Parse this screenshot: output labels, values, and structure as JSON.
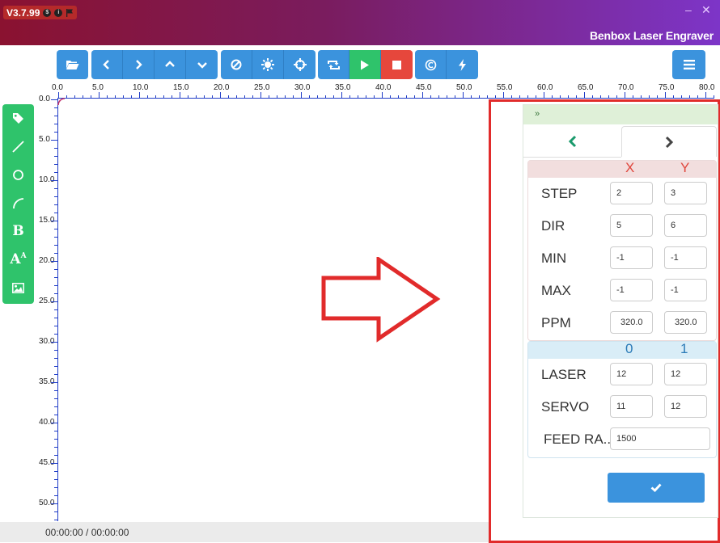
{
  "titlebar": {
    "version": "V3.7.99",
    "app_title": "Benbox Laser Engraver",
    "minimize": "–",
    "close": "✕"
  },
  "ruler": {
    "x_labels": [
      "0.0",
      "5.0",
      "10.0",
      "15.0",
      "20.0",
      "25.0",
      "30.0",
      "35.0",
      "40.0",
      "45.0",
      "50.0",
      "55.0",
      "60.0",
      "65.0",
      "70.0",
      "75.0",
      "80.0"
    ],
    "y_labels": [
      "0.0",
      "5.0",
      "10.0",
      "15.0",
      "20.0",
      "25.0",
      "30.0",
      "35.0",
      "40.0",
      "45.0",
      "50.0"
    ]
  },
  "toolbar": {
    "icons": [
      "folder-open",
      "chevron-left",
      "chevron-right",
      "chevron-up",
      "chevron-down",
      "ban",
      "sun",
      "crosshairs",
      "retweet",
      "play",
      "stop",
      "copyright",
      "bolt",
      "menu"
    ]
  },
  "tools": {
    "icons": [
      "tag",
      "line",
      "circle",
      "arc",
      "bold-text",
      "font-size",
      "image"
    ],
    "bold_label": "B",
    "font_label": "A"
  },
  "panel": {
    "collapse_label": "»",
    "tab_prev": "‹",
    "tab_next": "›",
    "axes": {
      "col_x": "X",
      "col_y": "Y",
      "rows": [
        {
          "label": "STEP",
          "x": "2",
          "y": "3"
        },
        {
          "label": "DIR",
          "x": "5",
          "y": "6"
        },
        {
          "label": "MIN",
          "x": "-1",
          "y": "-1"
        },
        {
          "label": "MAX",
          "x": "-1",
          "y": "-1"
        },
        {
          "label": "PPM",
          "x": "320.0",
          "y": "320.0"
        }
      ]
    },
    "outputs": {
      "col_0": "0",
      "col_1": "1",
      "rows": [
        {
          "label": "LASER",
          "v0": "12",
          "v1": "12"
        },
        {
          "label": "SERVO",
          "v0": "11",
          "v1": "12"
        }
      ],
      "feed_label": "FEED RA..",
      "feed_value": "1500"
    },
    "confirm_icon": "checkmark"
  },
  "status": {
    "time": "00:00:00 / 00:00:00"
  },
  "colors": {
    "accent_blue": "#3b93dd",
    "green": "#2fc36b",
    "red": "#e6473c",
    "highlight": "#e12b2b"
  }
}
